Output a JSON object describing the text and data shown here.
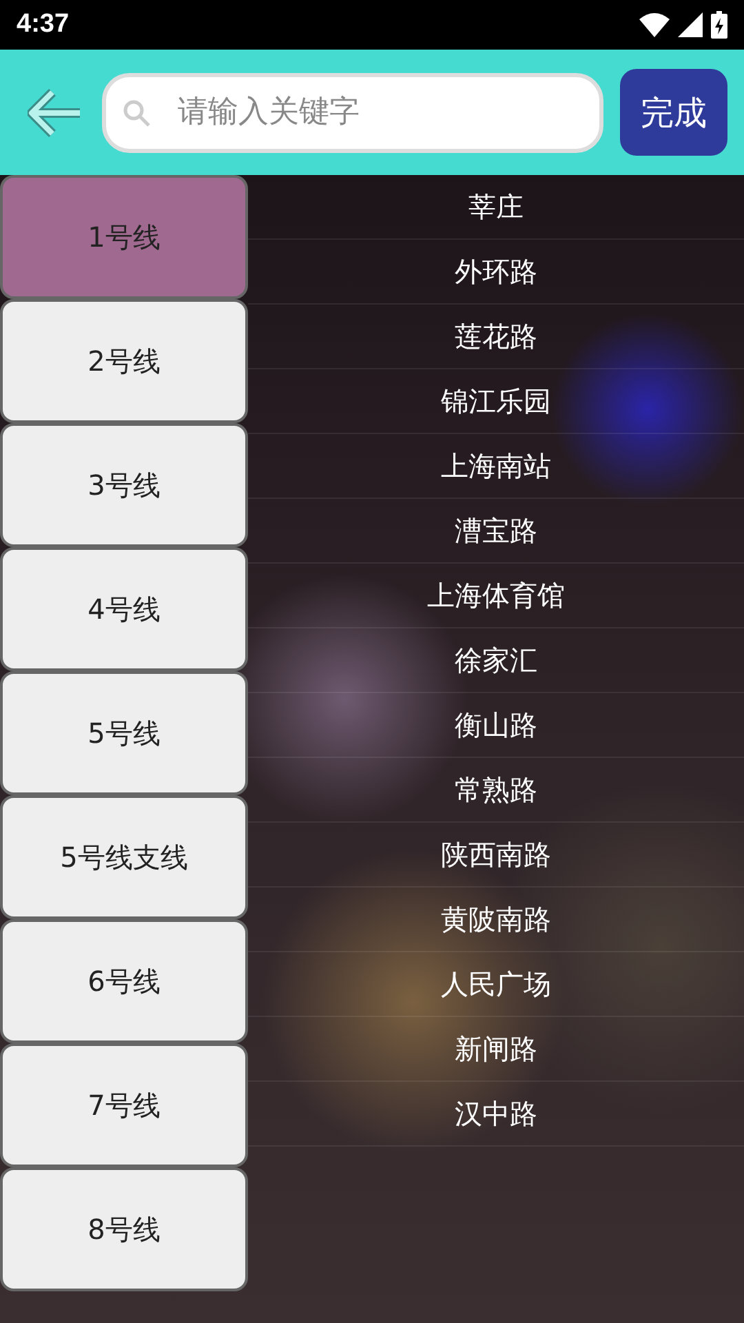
{
  "status_bar": {
    "time": "4:37"
  },
  "header": {
    "search": {
      "placeholder": "请输入关键字"
    },
    "done_button": "完成"
  },
  "lines": [
    {
      "label": "1号线",
      "selected": true
    },
    {
      "label": "2号线",
      "selected": false
    },
    {
      "label": "3号线",
      "selected": false
    },
    {
      "label": "4号线",
      "selected": false
    },
    {
      "label": "5号线",
      "selected": false
    },
    {
      "label": "5号线支线",
      "selected": false
    },
    {
      "label": "6号线",
      "selected": false
    },
    {
      "label": "7号线",
      "selected": false
    },
    {
      "label": "8号线",
      "selected": false
    }
  ],
  "stations": [
    "莘庄",
    "外环路",
    "莲花路",
    "锦江乐园",
    "上海南站",
    "漕宝路",
    "上海体育馆",
    "徐家汇",
    "衡山路",
    "常熟路",
    "陕西南路",
    "黄陂南路",
    "人民广场",
    "新闸路",
    "汉中路"
  ]
}
